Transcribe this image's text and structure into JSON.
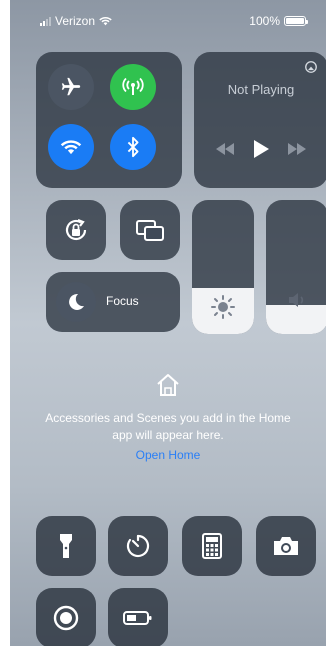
{
  "status": {
    "carrier": "Verizon",
    "battery": "100%"
  },
  "music": {
    "title": "Not Playing"
  },
  "focus": {
    "label": "Focus"
  },
  "sliders": {
    "brightness": 0.34,
    "volume": 0.22
  },
  "home": {
    "message": "Accessories and Scenes you add in the Home app will appear here.",
    "link": "Open Home"
  },
  "colors": {
    "cellular": "#30c24f",
    "wifi": "#1a7cf5",
    "bluetooth": "#1a7cf5",
    "link": "#2a7ff6"
  },
  "icons": {
    "airplane": "airplane-icon",
    "cellular": "antenna-icon",
    "wifi": "wifi-icon",
    "bluetooth": "bluetooth-icon",
    "rotation_lock": "rotation-lock-icon",
    "screen_mirroring": "screen-mirroring-icon",
    "focus": "moon-icon",
    "brightness": "sun-icon",
    "volume": "speaker-icon",
    "home": "home-icon",
    "flashlight": "flashlight-icon",
    "timer": "timer-icon",
    "calculator": "calculator-icon",
    "camera": "camera-icon",
    "screen_record": "record-icon",
    "low_power": "battery-icon"
  }
}
